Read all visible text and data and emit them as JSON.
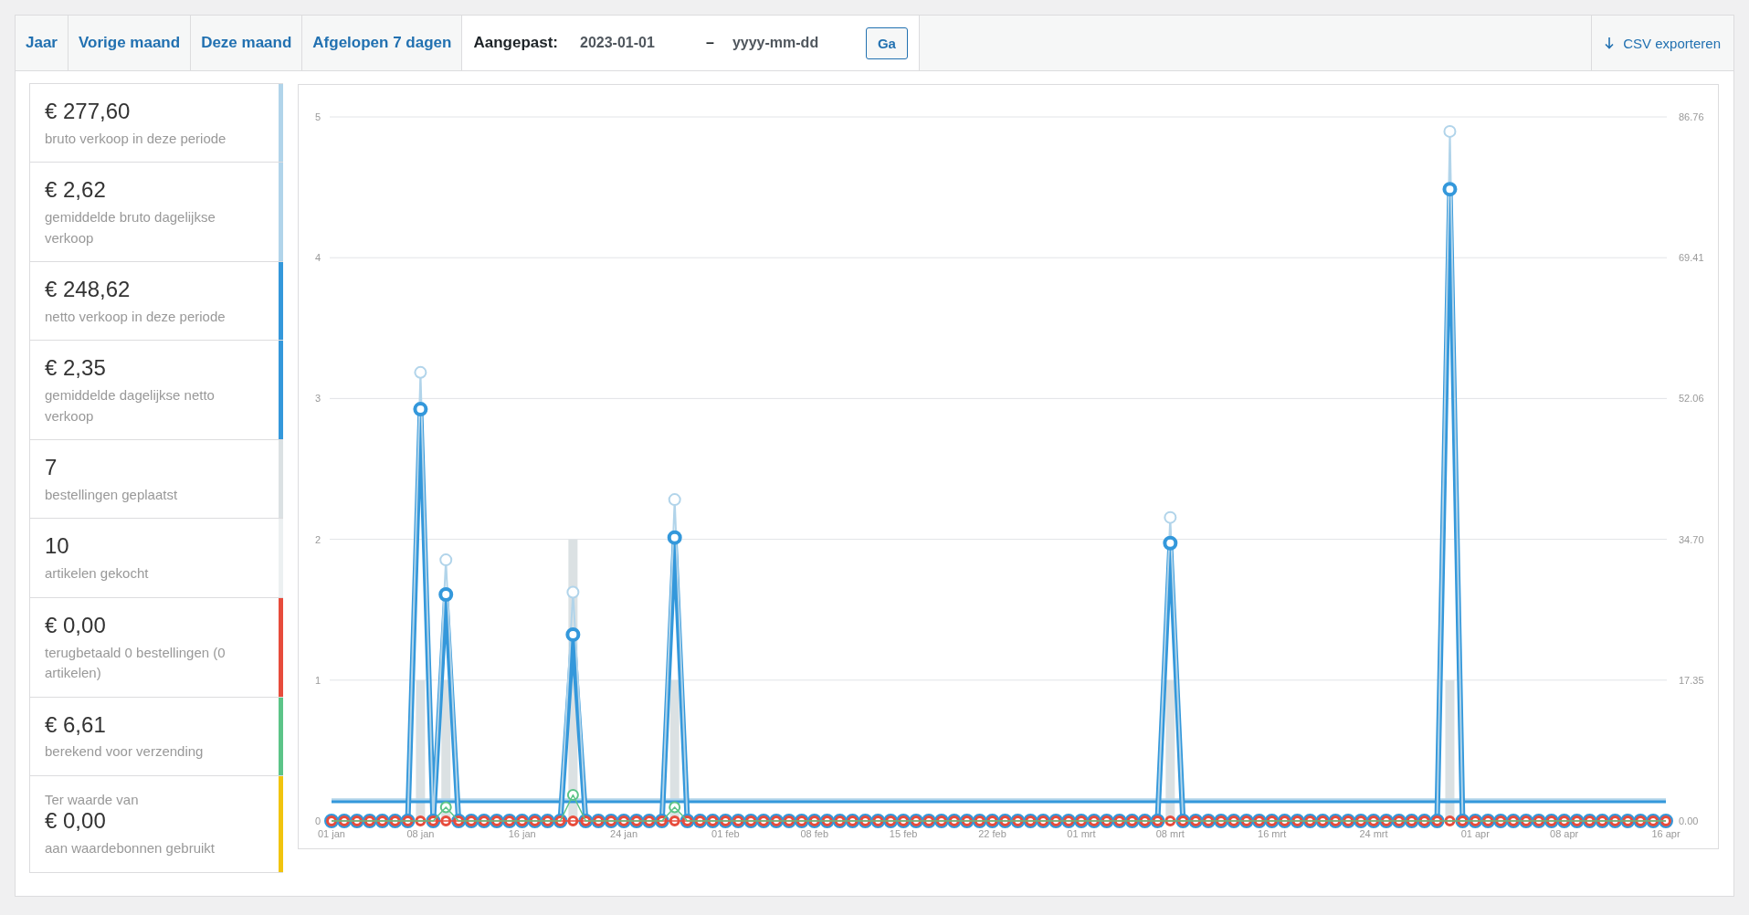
{
  "range_tabs": [
    {
      "label": "Jaar"
    },
    {
      "label": "Vorige maand"
    },
    {
      "label": "Deze maand"
    },
    {
      "label": "Afgelopen 7 dagen"
    }
  ],
  "custom_range": {
    "label": "Aangepast:",
    "start_date": "2023-01-01",
    "separator": "–",
    "end_date_placeholder": "yyyy-mm-dd",
    "button": "Ga"
  },
  "export_link": "CSV exporteren",
  "legend": [
    {
      "value": "€ 277,60",
      "label": "bruto verkoop in deze periode",
      "color": "#b1d4ea"
    },
    {
      "value": "€ 2,62",
      "label": "gemiddelde bruto dagelijkse verkoop",
      "color": "#b1d4ea"
    },
    {
      "value": "€ 248,62",
      "label": "netto verkoop in deze periode",
      "color": "#3498db"
    },
    {
      "value": "€ 2,35",
      "label": "gemiddelde dagelijkse netto verkoop",
      "color": "#3498db"
    },
    {
      "value": "7",
      "label": "bestellingen geplaatst",
      "color": "#dbe1e3"
    },
    {
      "value": "10",
      "label": "artikelen gekocht",
      "color": "#ecf0f1"
    },
    {
      "value": "€ 0,00",
      "label": "terugbetaald 0 bestellingen (0 artikelen)",
      "color": "#e74c3c"
    },
    {
      "value": "€ 6,61",
      "label": "berekend voor verzending",
      "color": "#5cc488"
    },
    {
      "prefix": "Ter waarde van",
      "value": "€ 0,00",
      "label": "aan waardebonnen gebruikt",
      "color": "#f1c40f"
    }
  ],
  "orders_chart": {
    "chart_data": {
      "type": "bar",
      "grid": true,
      "ylim": [
        0,
        5
      ],
      "yticks": [
        0,
        1,
        2,
        3,
        4,
        5
      ],
      "categories": [
        "01 jan",
        null,
        null,
        null,
        null,
        null,
        null,
        "08 jan",
        null,
        null,
        null,
        null,
        null,
        null,
        null,
        "16 jan",
        null,
        null,
        null,
        null,
        null,
        null,
        null,
        "24 jan",
        null,
        null,
        null,
        null,
        null,
        null,
        null,
        "01 feb",
        null,
        null,
        null,
        null,
        null,
        null,
        "08 feb",
        null,
        null,
        null,
        null,
        null,
        null,
        "15 feb",
        null,
        null,
        null,
        null,
        null,
        null,
        "22 feb",
        null,
        null,
        null,
        null,
        null,
        null,
        "01 mrt",
        null,
        null,
        null,
        null,
        null,
        null,
        "08 mrt",
        null,
        null,
        null,
        null,
        null,
        null,
        null,
        "16 mrt",
        null,
        null,
        null,
        null,
        null,
        null,
        null,
        "24 mrt",
        null,
        null,
        null,
        null,
        null,
        null,
        null,
        "01 apr",
        null,
        null,
        null,
        null,
        null,
        null,
        "08 apr",
        null,
        null,
        null,
        null,
        null,
        null,
        null,
        "16 apr"
      ],
      "series": [
        {
          "color": "#dbe1e3",
          "values": [
            0,
            0,
            0,
            0,
            0,
            0,
            0,
            1,
            0,
            1,
            0,
            0,
            0,
            0,
            0,
            0,
            0,
            0,
            0,
            2,
            0,
            0,
            0,
            0,
            0,
            0,
            0,
            1,
            0,
            0,
            0,
            0,
            0,
            0,
            0,
            0,
            0,
            0,
            0,
            0,
            0,
            0,
            0,
            0,
            0,
            0,
            0,
            0,
            0,
            0,
            0,
            0,
            0,
            0,
            0,
            0,
            0,
            0,
            0,
            0,
            0,
            0,
            0,
            0,
            0,
            0,
            1,
            0,
            0,
            0,
            0,
            0,
            0,
            0,
            0,
            0,
            0,
            0,
            0,
            0,
            0,
            0,
            0,
            0,
            0,
            0,
            0,
            0,
            1,
            0,
            0,
            0,
            0,
            0,
            0,
            0,
            0,
            0,
            0,
            0,
            0,
            0,
            0,
            0,
            0,
            0
          ]
        }
      ]
    }
  },
  "sales_chart": {
    "chart_data": {
      "type": "line",
      "ylim": [
        0,
        86.76
      ],
      "yticks": [
        {
          "value": 0,
          "label": "0.00"
        },
        {
          "value": 17.35,
          "label": "17.35"
        },
        {
          "value": 34.7,
          "label": "34.70"
        },
        {
          "value": 52.06,
          "label": "52.06"
        },
        {
          "value": 69.41,
          "label": "69.41"
        },
        {
          "value": 86.76,
          "label": "86.76"
        }
      ],
      "series": [
        {
          "color": "#b1d4ea",
          "values": [
            2.62,
            2.62,
            2.62,
            2.62,
            2.62,
            2.62,
            2.62,
            2.62,
            2.62,
            2.62,
            2.62,
            2.62,
            2.62,
            2.62,
            2.62,
            2.62,
            2.62,
            2.62,
            2.62,
            2.62,
            2.62,
            2.62,
            2.62,
            2.62,
            2.62,
            2.62,
            2.62,
            2.62,
            2.62,
            2.62,
            2.62,
            2.62,
            2.62,
            2.62,
            2.62,
            2.62,
            2.62,
            2.62,
            2.62,
            2.62,
            2.62,
            2.62,
            2.62,
            2.62,
            2.62,
            2.62,
            2.62,
            2.62,
            2.62,
            2.62,
            2.62,
            2.62,
            2.62,
            2.62,
            2.62,
            2.62,
            2.62,
            2.62,
            2.62,
            2.62,
            2.62,
            2.62,
            2.62,
            2.62,
            2.62,
            2.62,
            2.62,
            2.62,
            2.62,
            2.62,
            2.62,
            2.62,
            2.62,
            2.62,
            2.62,
            2.62,
            2.62,
            2.62,
            2.62,
            2.62,
            2.62,
            2.62,
            2.62,
            2.62,
            2.62,
            2.62,
            2.62,
            2.62,
            2.62,
            2.62,
            2.62,
            2.62,
            2.62,
            2.62,
            2.62,
            2.62,
            2.62,
            2.62,
            2.62,
            2.62,
            2.62,
            2.62,
            2.62,
            2.62,
            2.62,
            2.62
          ]
        },
        {
          "color": "#3498db",
          "values": [
            2.35,
            2.35,
            2.35,
            2.35,
            2.35,
            2.35,
            2.35,
            2.35,
            2.35,
            2.35,
            2.35,
            2.35,
            2.35,
            2.35,
            2.35,
            2.35,
            2.35,
            2.35,
            2.35,
            2.35,
            2.35,
            2.35,
            2.35,
            2.35,
            2.35,
            2.35,
            2.35,
            2.35,
            2.35,
            2.35,
            2.35,
            2.35,
            2.35,
            2.35,
            2.35,
            2.35,
            2.35,
            2.35,
            2.35,
            2.35,
            2.35,
            2.35,
            2.35,
            2.35,
            2.35,
            2.35,
            2.35,
            2.35,
            2.35,
            2.35,
            2.35,
            2.35,
            2.35,
            2.35,
            2.35,
            2.35,
            2.35,
            2.35,
            2.35,
            2.35,
            2.35,
            2.35,
            2.35,
            2.35,
            2.35,
            2.35,
            2.35,
            2.35,
            2.35,
            2.35,
            2.35,
            2.35,
            2.35,
            2.35,
            2.35,
            2.35,
            2.35,
            2.35,
            2.35,
            2.35,
            2.35,
            2.35,
            2.35,
            2.35,
            2.35,
            2.35,
            2.35,
            2.35,
            2.35,
            2.35,
            2.35,
            2.35,
            2.35,
            2.35,
            2.35,
            2.35,
            2.35,
            2.35,
            2.35,
            2.35,
            2.35,
            2.35,
            2.35,
            2.35,
            2.35,
            2.35
          ]
        },
        {
          "color": "#b1d4ea",
          "marker": true,
          "values": [
            0,
            0,
            0,
            0,
            0,
            0,
            0,
            55.27,
            0,
            32.17,
            0,
            0,
            0,
            0,
            0,
            0,
            0,
            0,
            0,
            28.19,
            0,
            0,
            0,
            0,
            0,
            0,
            0,
            39.6,
            0,
            0,
            0,
            0,
            0,
            0,
            0,
            0,
            0,
            0,
            0,
            0,
            0,
            0,
            0,
            0,
            0,
            0,
            0,
            0,
            0,
            0,
            0,
            0,
            0,
            0,
            0,
            0,
            0,
            0,
            0,
            0,
            0,
            0,
            0,
            0,
            0,
            0,
            37.4,
            0,
            0,
            0,
            0,
            0,
            0,
            0,
            0,
            0,
            0,
            0,
            0,
            0,
            0,
            0,
            0,
            0,
            0,
            0,
            0,
            0,
            84.97,
            0,
            0,
            0,
            0,
            0,
            0,
            0,
            0,
            0,
            0,
            0,
            0,
            0,
            0,
            0,
            0,
            0
          ]
        },
        {
          "color": "#3498db",
          "marker": true,
          "values": [
            0,
            0,
            0,
            0,
            0,
            0,
            0,
            50.74,
            0,
            27.91,
            0,
            0,
            0,
            0,
            0,
            0,
            0,
            0,
            0,
            22.96,
            0,
            0,
            0,
            0,
            0,
            0,
            0,
            34.92,
            0,
            0,
            0,
            0,
            0,
            0,
            0,
            0,
            0,
            0,
            0,
            0,
            0,
            0,
            0,
            0,
            0,
            0,
            0,
            0,
            0,
            0,
            0,
            0,
            0,
            0,
            0,
            0,
            0,
            0,
            0,
            0,
            0,
            0,
            0,
            0,
            0,
            0,
            34.24,
            0,
            0,
            0,
            0,
            0,
            0,
            0,
            0,
            0,
            0,
            0,
            0,
            0,
            0,
            0,
            0,
            0,
            0,
            0,
            0,
            0,
            77.85,
            0,
            0,
            0,
            0,
            0,
            0,
            0,
            0,
            0,
            0,
            0,
            0,
            0,
            0,
            0,
            0,
            0
          ]
        },
        {
          "color": "#5cc488",
          "marker": true,
          "values": [
            0,
            0,
            0,
            0,
            0,
            0,
            0,
            0,
            0,
            1.7,
            0,
            0,
            0,
            0,
            0,
            0,
            0,
            0,
            0,
            3.21,
            0,
            0,
            0,
            0,
            0,
            0,
            0,
            1.7,
            0,
            0,
            0,
            0,
            0,
            0,
            0,
            0,
            0,
            0,
            0,
            0,
            0,
            0,
            0,
            0,
            0,
            0,
            0,
            0,
            0,
            0,
            0,
            0,
            0,
            0,
            0,
            0,
            0,
            0,
            0,
            0,
            0,
            0,
            0,
            0,
            0,
            0,
            0,
            0,
            0,
            0,
            0,
            0,
            0,
            0,
            0,
            0,
            0,
            0,
            0,
            0,
            0,
            0,
            0,
            0,
            0,
            0,
            0,
            0,
            0,
            0,
            0,
            0,
            0,
            0,
            0,
            0,
            0,
            0,
            0,
            0,
            0,
            0,
            0,
            0,
            0,
            0
          ]
        },
        {
          "color": "#e74c3c",
          "marker": true,
          "values": [
            0,
            0,
            0,
            0,
            0,
            0,
            0,
            0,
            0,
            0,
            0,
            0,
            0,
            0,
            0,
            0,
            0,
            0,
            0,
            0,
            0,
            0,
            0,
            0,
            0,
            0,
            0,
            0,
            0,
            0,
            0,
            0,
            0,
            0,
            0,
            0,
            0,
            0,
            0,
            0,
            0,
            0,
            0,
            0,
            0,
            0,
            0,
            0,
            0,
            0,
            0,
            0,
            0,
            0,
            0,
            0,
            0,
            0,
            0,
            0,
            0,
            0,
            0,
            0,
            0,
            0,
            0,
            0,
            0,
            0,
            0,
            0,
            0,
            0,
            0,
            0,
            0,
            0,
            0,
            0,
            0,
            0,
            0,
            0,
            0,
            0,
            0,
            0,
            0,
            0,
            0,
            0,
            0,
            0,
            0,
            0,
            0,
            0,
            0,
            0,
            0,
            0,
            0,
            0,
            0,
            0
          ]
        }
      ]
    }
  }
}
